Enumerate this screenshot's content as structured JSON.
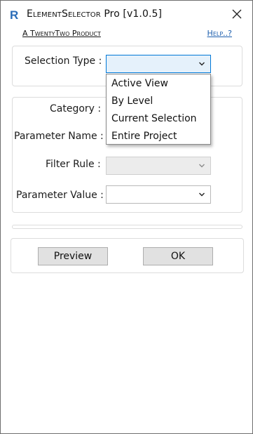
{
  "window": {
    "title_prefix": "E",
    "title_sc": "lement",
    "title_mid": "S",
    "title_sc2": "elector",
    "title_suffix": "Pro [v1.0.5]"
  },
  "links": {
    "product": "A TwentyTwo Product",
    "help": "Help..?"
  },
  "selection": {
    "label": "Selection Type :",
    "value": "",
    "options": [
      "Active View",
      "By Level",
      "Current Selection",
      "Entire Project"
    ]
  },
  "filters": {
    "category_label": "Category :",
    "parameter_name_label": "Parameter Name :",
    "filter_rule_label": "Filter Rule :",
    "parameter_value_label": "Parameter Value :"
  },
  "buttons": {
    "preview": "Preview",
    "ok": "OK"
  },
  "colors": {
    "accent": "#0078d7",
    "link": "#1d5fae",
    "icon_blue": "#2a6cb8"
  }
}
